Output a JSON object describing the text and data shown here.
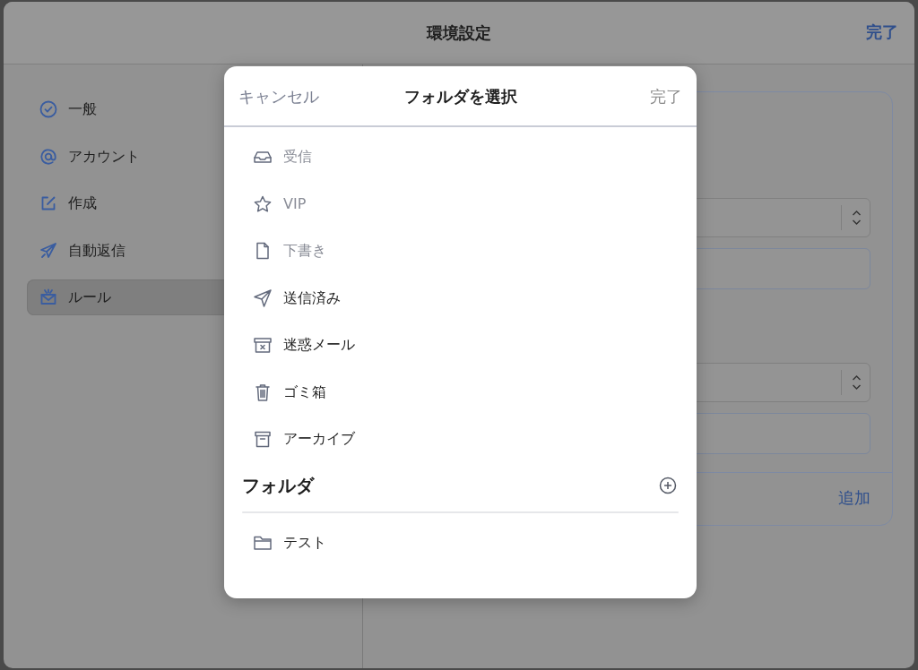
{
  "window": {
    "title": "環境設定",
    "done": "完了"
  },
  "sidebar": {
    "items": [
      {
        "label": "一般",
        "selected": false
      },
      {
        "label": "アカウント",
        "selected": false
      },
      {
        "label": "作成",
        "selected": false
      },
      {
        "label": "自動返信",
        "selected": false
      },
      {
        "label": "ルール",
        "selected": true
      }
    ]
  },
  "rule_card": {
    "fields": [
      {
        "kind": "select"
      },
      {
        "kind": "input"
      },
      {
        "kind": "gap"
      },
      {
        "kind": "select"
      },
      {
        "kind": "input"
      }
    ],
    "add_button": "追加"
  },
  "dialog": {
    "cancel": "キャンセル",
    "title": "フォルダを選択",
    "done": "完了",
    "mailboxes": [
      {
        "label": "受信",
        "disabled": true
      },
      {
        "label": "VIP",
        "disabled": true
      },
      {
        "label": "下書き",
        "disabled": true
      },
      {
        "label": "送信済み",
        "disabled": false
      },
      {
        "label": "迷惑メール",
        "disabled": false
      },
      {
        "label": "ゴミ箱",
        "disabled": false
      },
      {
        "label": "アーカイブ",
        "disabled": false
      }
    ],
    "folders_heading": "フォルダ",
    "folders": [
      {
        "label": "テスト"
      }
    ]
  }
}
